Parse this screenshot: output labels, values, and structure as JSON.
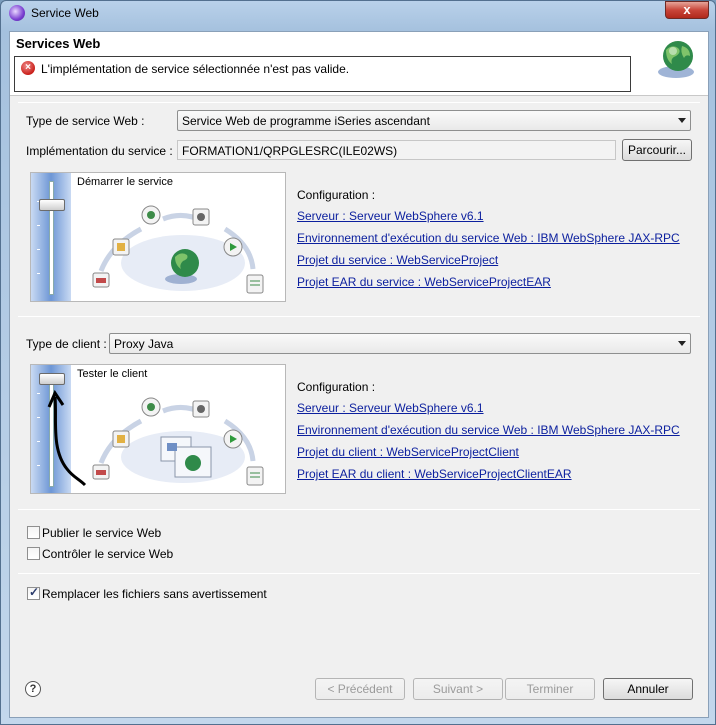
{
  "window": {
    "title": "Service Web",
    "close_label": "x"
  },
  "banner": {
    "title": "Services Web",
    "error_message": "L'implémentation de service sélectionnée n'est pas valide."
  },
  "service": {
    "type_label": "Type de service Web :",
    "type_value": "Service Web de programme iSeries ascendant",
    "impl_label": "Implémentation du service :",
    "impl_value": "FORMATION1/QRPGLESRC(ILE02WS)",
    "browse_label": "Parcourir...",
    "panel_label": "Démarrer le service",
    "config_title": "Configuration :",
    "links": [
      "Serveur : Serveur WebSphere v6.1",
      "Environnement d'exécution du service Web : IBM WebSphere JAX-RPC",
      "Projet du service : WebServiceProject",
      "Projet EAR du service : WebServiceProjectEAR"
    ]
  },
  "client": {
    "type_label": "Type de client :",
    "type_value": "Proxy Java",
    "panel_label": "Tester le client",
    "config_title": "Configuration :",
    "links": [
      "Serveur : Serveur WebSphere v6.1",
      "Environnement d'exécution du service Web : IBM WebSphere JAX-RPC",
      "Projet du client : WebServiceProjectClient",
      "Projet EAR du client : WebServiceProjectClientEAR"
    ]
  },
  "options": {
    "publish_label": "Publier le service Web",
    "monitor_label": "Contrôler le service Web",
    "overwrite_label": "Remplacer les fichiers sans avertissement",
    "publish_checked": false,
    "monitor_checked": false,
    "overwrite_checked": true
  },
  "footer": {
    "back_label": "< Précédent",
    "next_label": "Suivant >",
    "finish_label": "Terminer",
    "cancel_label": "Annuler",
    "help_label": "?"
  }
}
